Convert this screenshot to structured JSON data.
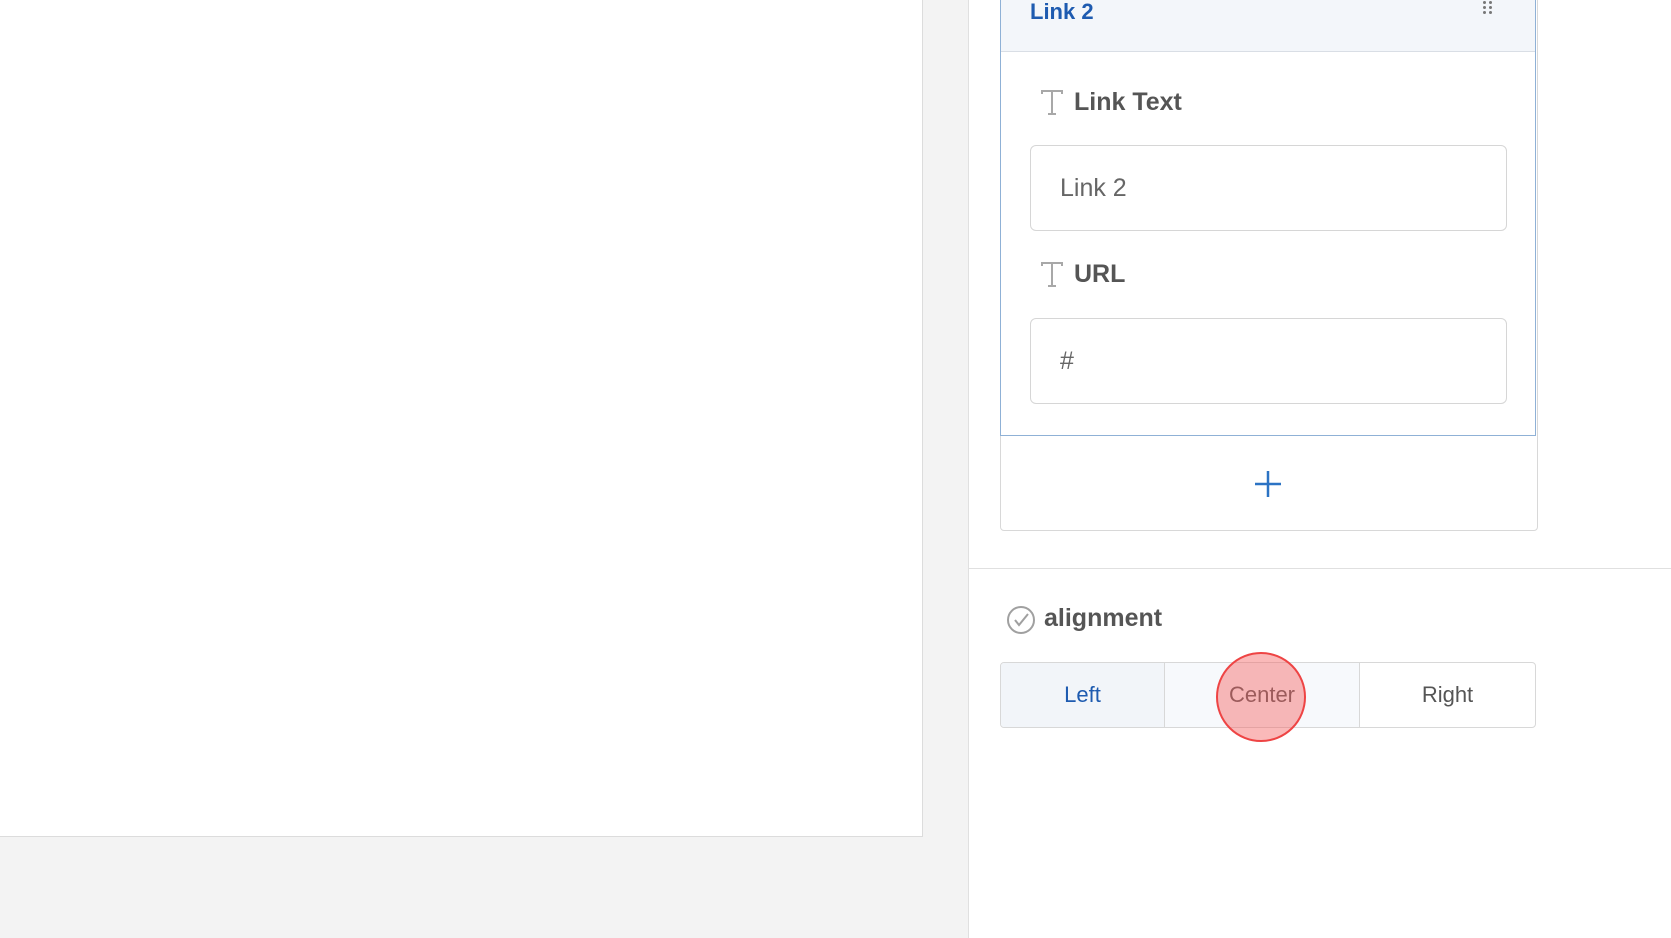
{
  "link_item": {
    "title": "Link 2",
    "link_text_label": "Link Text",
    "link_text_value": "Link 2",
    "url_label": "URL",
    "url_value": "#"
  },
  "add_button": {
    "icon": "plus-icon"
  },
  "alignment": {
    "label": "alignment",
    "options": [
      "Left",
      "Center",
      "Right"
    ],
    "selected": "Left"
  },
  "colors": {
    "accent": "#1e5bb0",
    "click_marker": "#ee4444"
  }
}
